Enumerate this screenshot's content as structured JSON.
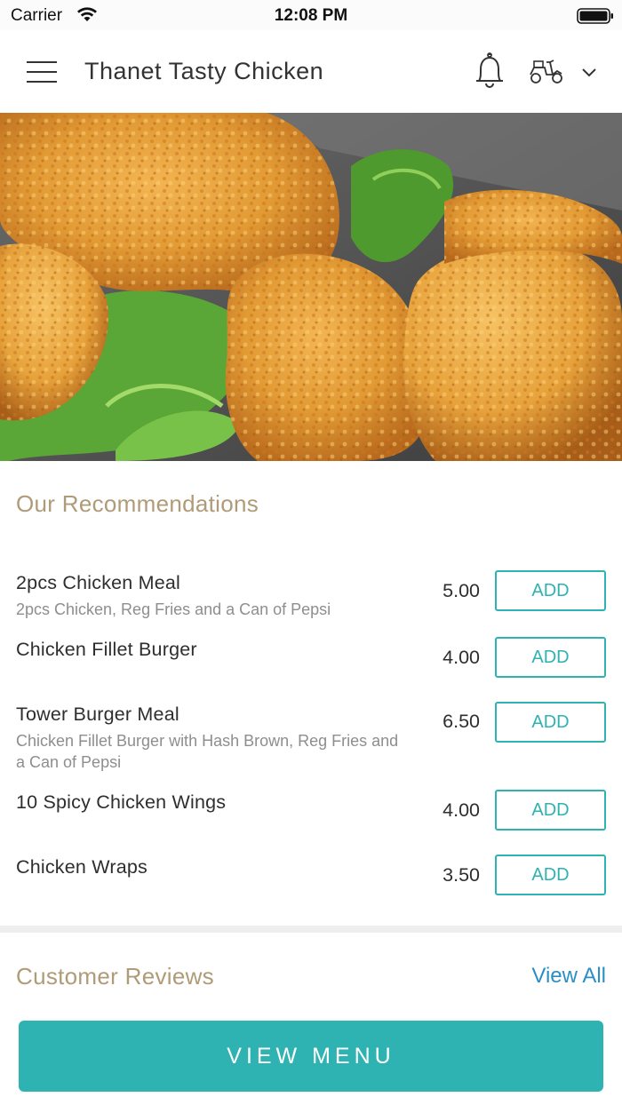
{
  "status_bar": {
    "carrier": "Carrier",
    "time": "12:08 PM"
  },
  "header": {
    "title": "Thanet Tasty Chicken",
    "icons": [
      "menu-icon",
      "bell-icon",
      "scooter-icon",
      "chevron-down-icon"
    ]
  },
  "hero": {
    "image": "fried-chicken-pieces-with-lettuce"
  },
  "recommendations": {
    "title": "Our Recommendations",
    "items": [
      {
        "name": "2pcs Chicken Meal",
        "description": "2pcs Chicken, Reg Fries and a Can of Pepsi",
        "price": "5.00",
        "button": "ADD"
      },
      {
        "name": "Chicken Fillet Burger",
        "description": "",
        "price": "4.00",
        "button": "ADD"
      },
      {
        "name": "Tower Burger Meal",
        "description": "Chicken Fillet Burger with Hash Brown, Reg Fries and a Can of Pepsi",
        "price": "6.50",
        "button": "ADD"
      },
      {
        "name": "10 Spicy Chicken Wings",
        "description": "",
        "price": "4.00",
        "button": "ADD"
      },
      {
        "name": "Chicken Wraps",
        "description": "",
        "price": "3.50",
        "button": "ADD"
      }
    ]
  },
  "reviews": {
    "title": "Customer Reviews",
    "view_all": "View All"
  },
  "footer": {
    "view_menu": "VIEW MENU"
  },
  "colors": {
    "accent": "#2eb2b2",
    "section_title": "#b09b78",
    "link": "#2a8fc4"
  }
}
